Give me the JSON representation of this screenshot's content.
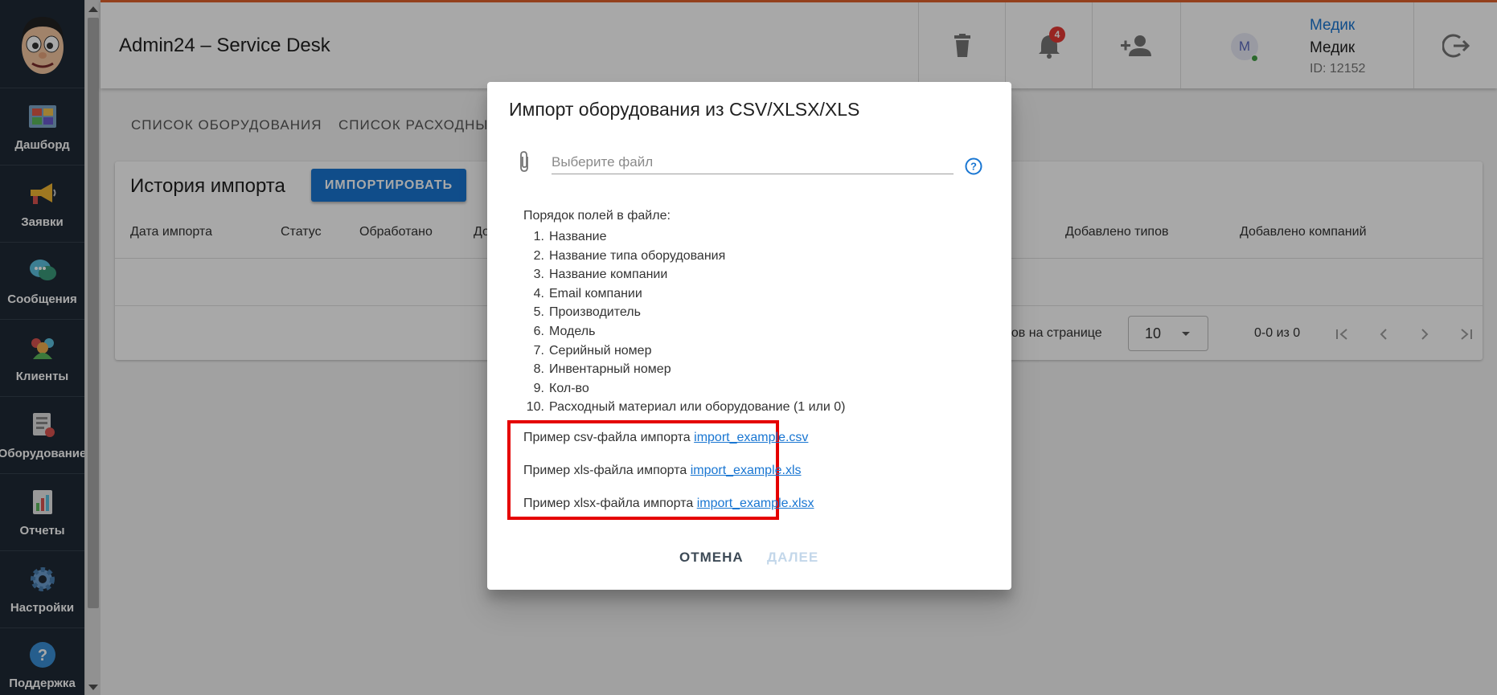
{
  "app": {
    "title": "Admin24 – Service Desk"
  },
  "sidebar": {
    "items": [
      {
        "label": "Дашборд",
        "icon": "dashboard-icon"
      },
      {
        "label": "Заявки",
        "icon": "megaphone-icon"
      },
      {
        "label": "Сообщения",
        "icon": "chat-icon"
      },
      {
        "label": "Клиенты",
        "icon": "clients-icon"
      },
      {
        "label": "Оборудование",
        "icon": "equipment-icon"
      },
      {
        "label": "Отчеты",
        "icon": "reports-icon"
      },
      {
        "label": "Настройки",
        "icon": "gear-icon"
      },
      {
        "label": "Поддержка",
        "icon": "help-icon"
      }
    ]
  },
  "header": {
    "notifications_count": "4",
    "user": {
      "link": "Медик",
      "name": "Медик",
      "id": "ID: 12152",
      "avatar_letter": "M"
    }
  },
  "tabs": [
    "СПИСОК ОБОРУДОВАНИЯ",
    "СПИСОК РАСХОДНЫХ"
  ],
  "card": {
    "title": "История импорта",
    "import_button": "ИМПОРТИРОВАТЬ",
    "columns": [
      "Дата импорта",
      "Статус",
      "Обработано",
      "До",
      "Добавлено типов",
      "Добавлено компаний"
    ],
    "pager": {
      "label": "ентов на странице",
      "per_page": "10",
      "range": "0-0 из 0"
    }
  },
  "dialog": {
    "title": "Импорт оборудования из CSV/XLSX/XLS",
    "file_placeholder": "Выберите файл",
    "order_title": "Порядок полей в файле:",
    "fields": [
      {
        "num": "1.",
        "text": "Название"
      },
      {
        "num": "2.",
        "text": "Название типа оборудования"
      },
      {
        "num": "3.",
        "text": "Название компании"
      },
      {
        "num": "4.",
        "text": "Email компании"
      },
      {
        "num": "5.",
        "text": "Производитель"
      },
      {
        "num": "6.",
        "text": "Модель"
      },
      {
        "num": "7.",
        "text": "Серийный номер"
      },
      {
        "num": "8.",
        "text": "Инвентарный номер"
      },
      {
        "num": "9.",
        "text": "Кол-во"
      },
      {
        "num": "10.",
        "text": "Расходный материал или оборудование (1 или 0)"
      }
    ],
    "examples": [
      {
        "text": "Пример csv-файла импорта",
        "link": "import_example.csv"
      },
      {
        "text": "Пример xls-файла импорта",
        "link": "import_example.xls"
      },
      {
        "text": "Пример xlsx-файла импорта",
        "link": "import_example.xlsx"
      }
    ],
    "cancel": "ОТМЕНА",
    "next": "ДАЛЕЕ"
  },
  "colors": {
    "primary": "#1976d2",
    "sidebar": "#1f2a36",
    "highlight": "#e50000",
    "badge": "#e53935"
  }
}
